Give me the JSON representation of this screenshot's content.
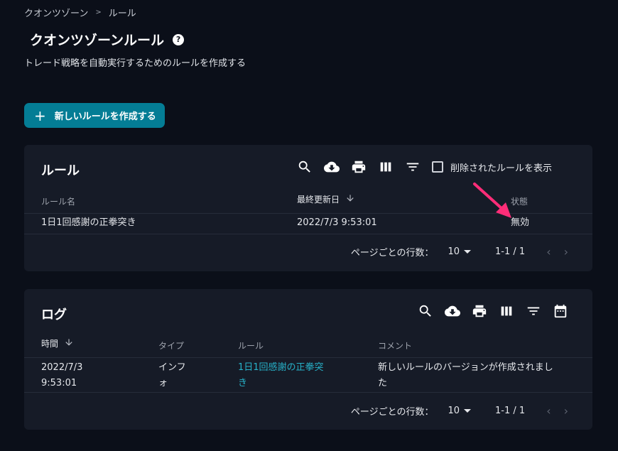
{
  "breadcrumb": {
    "parent": "クオンツゾーン",
    "current": "ルール"
  },
  "page": {
    "title": "クオンツゾーンルール",
    "subtitle": "トレード戦略を自動実行するためのルールを作成する",
    "new_rule_button": "新しいルールを作成する"
  },
  "rules": {
    "title": "ルール",
    "show_deleted_label": "削除されたルールを表示",
    "columns": {
      "name": "ルール名",
      "updated": "最終更新日",
      "status": "状態"
    },
    "rows": [
      {
        "name": "1日1回感謝の正拳突き",
        "updated": "2022/7/3 9:53:01",
        "status": "無効"
      }
    ],
    "pagination": {
      "rows_per_page_label": "ページごとの行数：",
      "rows_per_page": "10",
      "range": "1-1 / 1"
    }
  },
  "logs": {
    "title": "ログ",
    "columns": {
      "time": "時間",
      "type": "タイプ",
      "rule": "ルール",
      "comment": "コメント"
    },
    "rows": [
      {
        "time_line1": "2022/7/3",
        "time_line2": "9:53:01",
        "type_line1": "インフ",
        "type_line2": "ォ",
        "rule_line1": "1日1回感謝の正拳突",
        "rule_line2": "き",
        "comment_line1": "新しいルールのバージョンが作成されまし",
        "comment_line2": "た"
      }
    ],
    "pagination": {
      "rows_per_page_label": "ページごとの行数：",
      "rows_per_page": "10",
      "range": "1-1 / 1"
    }
  },
  "colors": {
    "background": "#0b0f19",
    "card": "#161b27",
    "accent": "#047d95",
    "link": "#27b2c9",
    "annotation": "#ff2d78"
  },
  "icons": [
    "search-icon",
    "download-icon",
    "print-icon",
    "columns-icon",
    "filter-icon",
    "calendar-icon",
    "help-icon",
    "sort-down-icon"
  ]
}
